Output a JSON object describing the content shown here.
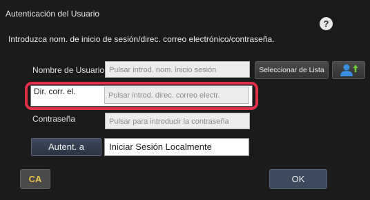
{
  "dialog": {
    "title": "Autenticación del Usuario",
    "instruction": "Introduzca nom. de inicio de sesión/direc. correo electrónico/contraseña.",
    "help_icon": "question-mark-icon"
  },
  "form": {
    "username": {
      "label": "Nombre de Usuario",
      "placeholder": "Pulsar introd. nom. inicio sesión"
    },
    "email": {
      "label": "Dir. corr. el.",
      "placeholder": "Pulsar introd. direc. correo electr."
    },
    "password": {
      "label": "Contraseña",
      "placeholder": "Pulsar para introducir la contraseña"
    },
    "auth_target": {
      "button_label": "Autent. a",
      "value": "Iniciar Sesión Localmente"
    }
  },
  "buttons": {
    "select_list": "Seleccionar de Lista",
    "address_book_icon": "user-select-icon",
    "clear": "CA",
    "ok": "OK"
  },
  "colors": {
    "highlight": "#e03048",
    "background": "#1b1b1b",
    "ca_text": "#e6c24a",
    "user_icon": "#3a8fe0"
  }
}
